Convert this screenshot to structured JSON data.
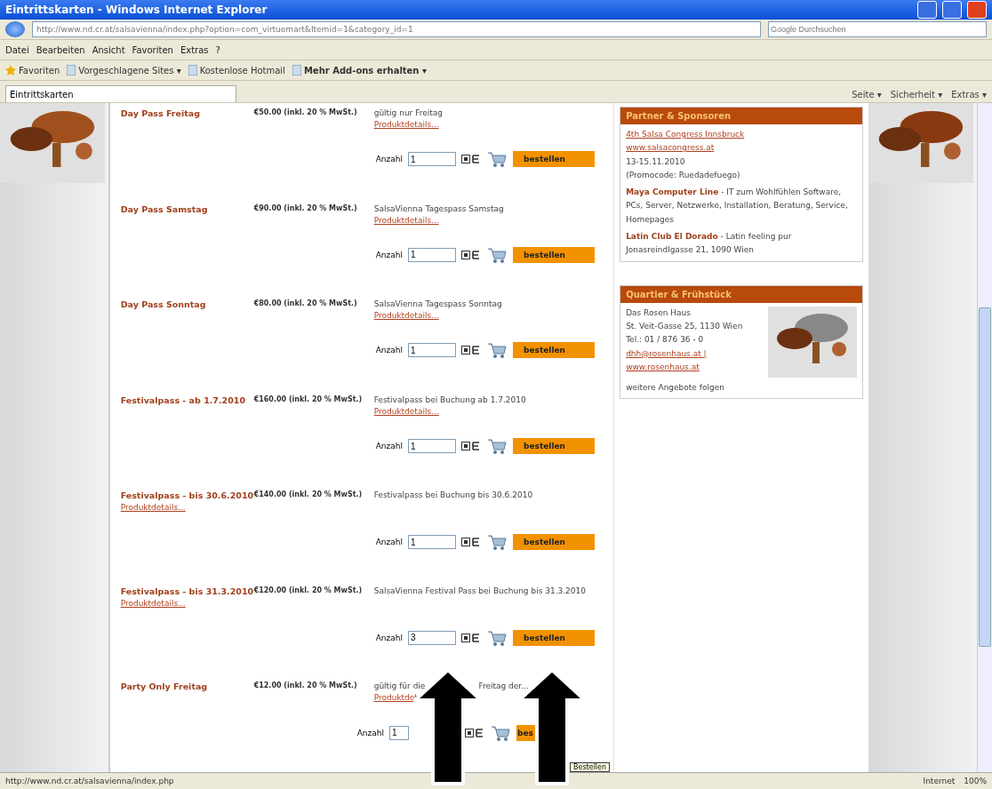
{
  "window": {
    "title": "Eintrittskarten - Windows Internet Explorer"
  },
  "address_bar": {
    "url": "http://www.nd.cr.at/salsavienna/index.php?option=com_virtuemart&Itemid=1&category_id=1"
  },
  "search": {
    "placeholder": "Google Durchsuchen"
  },
  "menu": [
    "Datei",
    "Bearbeiten",
    "Ansicht",
    "Favoriten",
    "Extras",
    "?"
  ],
  "favorites_bar": [
    {
      "label": "Favoriten",
      "kind": "star"
    },
    {
      "label": "Vorgeschlagene Sites ▾",
      "kind": "page"
    },
    {
      "label": "Kostenlose Hotmail",
      "kind": "page"
    },
    {
      "label": "Mehr Add-ons erhalten ▾",
      "kind": "bold"
    }
  ],
  "tab": {
    "label": "Eintrittskarten",
    "selected": true
  },
  "command_bar": [
    "Seite ▾",
    "Sicherheit ▾",
    "Extras ▾"
  ],
  "products": [
    {
      "name": "Day Pass Freitag",
      "price": "€50.00 (inkl. 20 % MwSt.)",
      "description": "gültig nur Freitag",
      "details": "Produktdetails...",
      "kind": "inline",
      "quantity_label": "Anzahl",
      "quantity": "1",
      "order": "bestellen"
    },
    {
      "name": "Day Pass Samstag",
      "price": "€90.00 (inkl. 20 % MwSt.)",
      "description": "SalsaVienna Tagespass Samstag",
      "details": "Produktdetails...",
      "kind": "inline",
      "quantity_label": "Anzahl",
      "quantity": "1",
      "order": "bestellen"
    },
    {
      "name": "Day Pass Sonntag",
      "price": "€80.00 (inkl. 20 % MwSt.)",
      "description": "SalsaVienna Tagespass Sonntag",
      "details": "Produktdetails...",
      "kind": "inline",
      "quantity_label": "Anzahl",
      "quantity": "1",
      "order": "bestellen"
    },
    {
      "name": "Festivalpass - ab 1.7.2010",
      "price": "€160.00 (inkl. 20 % MwSt.)",
      "description": "Festivalpass bei Buchung ab 1.7.2010",
      "details": "Produktdetails...",
      "kind": "inline",
      "quantity_label": "Anzahl",
      "quantity": "1",
      "order": "bestellen"
    },
    {
      "name": "Festivalpass - bis 30.6.2010",
      "price": "€140.00 (inkl. 20 % MwSt.)",
      "description": "Festivalpass bei Buchung bis 30.6.2010",
      "details": "Produktdetails...",
      "kind": "stacked",
      "quantity_label": "Anzahl",
      "quantity": "1",
      "order": "bestellen"
    },
    {
      "name": "Festivalpass - bis 31.3.2010",
      "price": "€120.00 (inkl. 20 % MwSt.)",
      "description": "SalsaVienna Festival Pass bei Buchung bis 31.3.2010",
      "details": "Produktdetails...",
      "kind": "stacked",
      "quantity_label": "Anzahl",
      "quantity": "3",
      "order": "bestellen"
    },
    {
      "name": "Party Only Freitag",
      "price": "€12.00 (inkl. 20 % MwSt.)",
      "description": "gültig für die",
      "description_end": "Freitag der...",
      "details": "Produktdet",
      "kind": "covered",
      "quantity_label": "Anzahl",
      "quantity": "1",
      "order": "bes"
    }
  ],
  "tooltip": "Bestellen",
  "sidebar": [
    {
      "title": "Partner & Sponsoren",
      "entries": [
        {
          "kind": "center",
          "lines": [
            "4th Salsa Congress Innsbruck",
            "www.salsacongress.at",
            "13-15.11.2010",
            "(Promocode: Ruedadefuego)"
          ]
        },
        {
          "kind": "lead",
          "lead": "Maya Computer Line",
          "text": " - IT zum Wohlfühlen Software, PCs, Server, Netzwerke, Installation, Beratung, Service, Homepages"
        },
        {
          "kind": "lead",
          "lead": "Latin Club El Dorado",
          "text": " - Latin feeling pur Jonasreindlgasse 21, 1090 Wien"
        }
      ]
    },
    {
      "title": "Quartier & Frühstück",
      "entries": [
        {
          "kind": "address",
          "lines": [
            "Das Rosen Haus",
            "St. Veit-Gasse 25, 1130 Wien",
            "Tel.: 01 / 876 36 - 0",
            "dhh@rosenhaus.at |",
            "www.rosenhaus.at"
          ]
        },
        {
          "kind": "plain",
          "text": "weitere Angebote folgen"
        }
      ]
    }
  ],
  "status_bar": {
    "url": "http://www.nd.cr.at/salsavienna/index.php",
    "zone": "Internet",
    "zoom": "100%"
  }
}
